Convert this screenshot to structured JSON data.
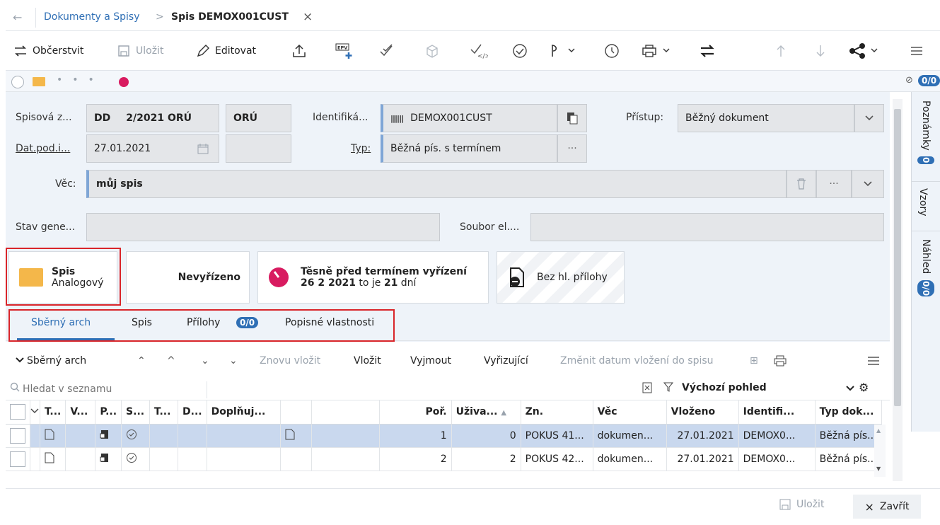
{
  "titlebar": {
    "back": "←",
    "breadcrumb": "Dokumenty a Spisy",
    "separator": ">",
    "title": "Spis DEMOX001CUST",
    "close": "×"
  },
  "toolbar": {
    "refresh": "Občerstvit",
    "save": "Uložit",
    "edit": "Editovat"
  },
  "status": {
    "attachments_badge": "0/0"
  },
  "form": {
    "spisova_label": "Spisová z...",
    "spis_id_1": "DD",
    "spis_id_2": "2/2021 ORÚ",
    "spis_org": "ORÚ",
    "identifikator_label": "Identifiká...",
    "identifikator_value": "DEMOX001CUST",
    "pristup_label": "Přístup:",
    "pristup_value": "Běžný dokument",
    "datum_label": "Dat.pod.i...",
    "datum_value": "27.01.2021",
    "typ_label": "Typ:",
    "typ_value": "Běžná pís. s termínem",
    "typ_ellipsis": "···",
    "vec_label": "Věc:",
    "vec_value": "můj spis",
    "vec_ellipsis": "···",
    "stav_label": "Stav gene...",
    "soubor_label": "Soubor el...."
  },
  "cards": {
    "spis_title": "Spis",
    "spis_sub": "Analogový",
    "stav": "Nevyřízeno",
    "termin_title": "Těsně před termínem vyřízení",
    "termin_date": "26 2 2021",
    "termin_mid": "to je",
    "termin_days": "21",
    "termin_unit": "dní",
    "priloha": "Bez hl. přílohy"
  },
  "tabs": {
    "sberny": "Sběrný arch",
    "spis": "Spis",
    "prilohy": "Přílohy",
    "prilohy_badge": "0/0",
    "popisne": "Popisné vlastnosti"
  },
  "list_toolbar": {
    "title": "Sběrný arch",
    "znovu": "Znovu vložit",
    "vlozit": "Vložit",
    "vyjmout": "Vyjmout",
    "vyrizujici": "Vyřizující",
    "zmenit": "Změnit datum vložení do spisu"
  },
  "search": {
    "placeholder": "Hledat v seznamu",
    "view": "Výchozí pohled"
  },
  "grid": {
    "headers": [
      "T...",
      "V...",
      "P...",
      "S...",
      "T...",
      "D...",
      "Doplňuj...",
      "",
      "",
      "Poř.",
      "Uživa...",
      "Zn.",
      "Věc",
      "Vloženo",
      "Identifi...",
      "Typ dok..."
    ],
    "rows": [
      [
        "1",
        "0",
        "POKUS 41...",
        "dokumen...",
        "27.01.2021",
        "DEMOX0...",
        "Běžná pís..."
      ],
      [
        "2",
        "2",
        "POKUS 42...",
        "dokumen...",
        "27.01.2021",
        "DEMOX0...",
        "Běžná pís..."
      ]
    ]
  },
  "rightpanel": {
    "poznamky": "Poznámky",
    "poznamky_badge": "0",
    "vzory": "Vzory",
    "nahled": "Náhled",
    "nahled_badge": "0/0"
  },
  "footer": {
    "save": "Uložit",
    "close_icon": "×",
    "close": "Zavřít"
  },
  "colors": {
    "accent": "#2f6fb5",
    "folder": "#f4b74a",
    "deadline": "#d81b60",
    "highlight": "#d9252a"
  }
}
